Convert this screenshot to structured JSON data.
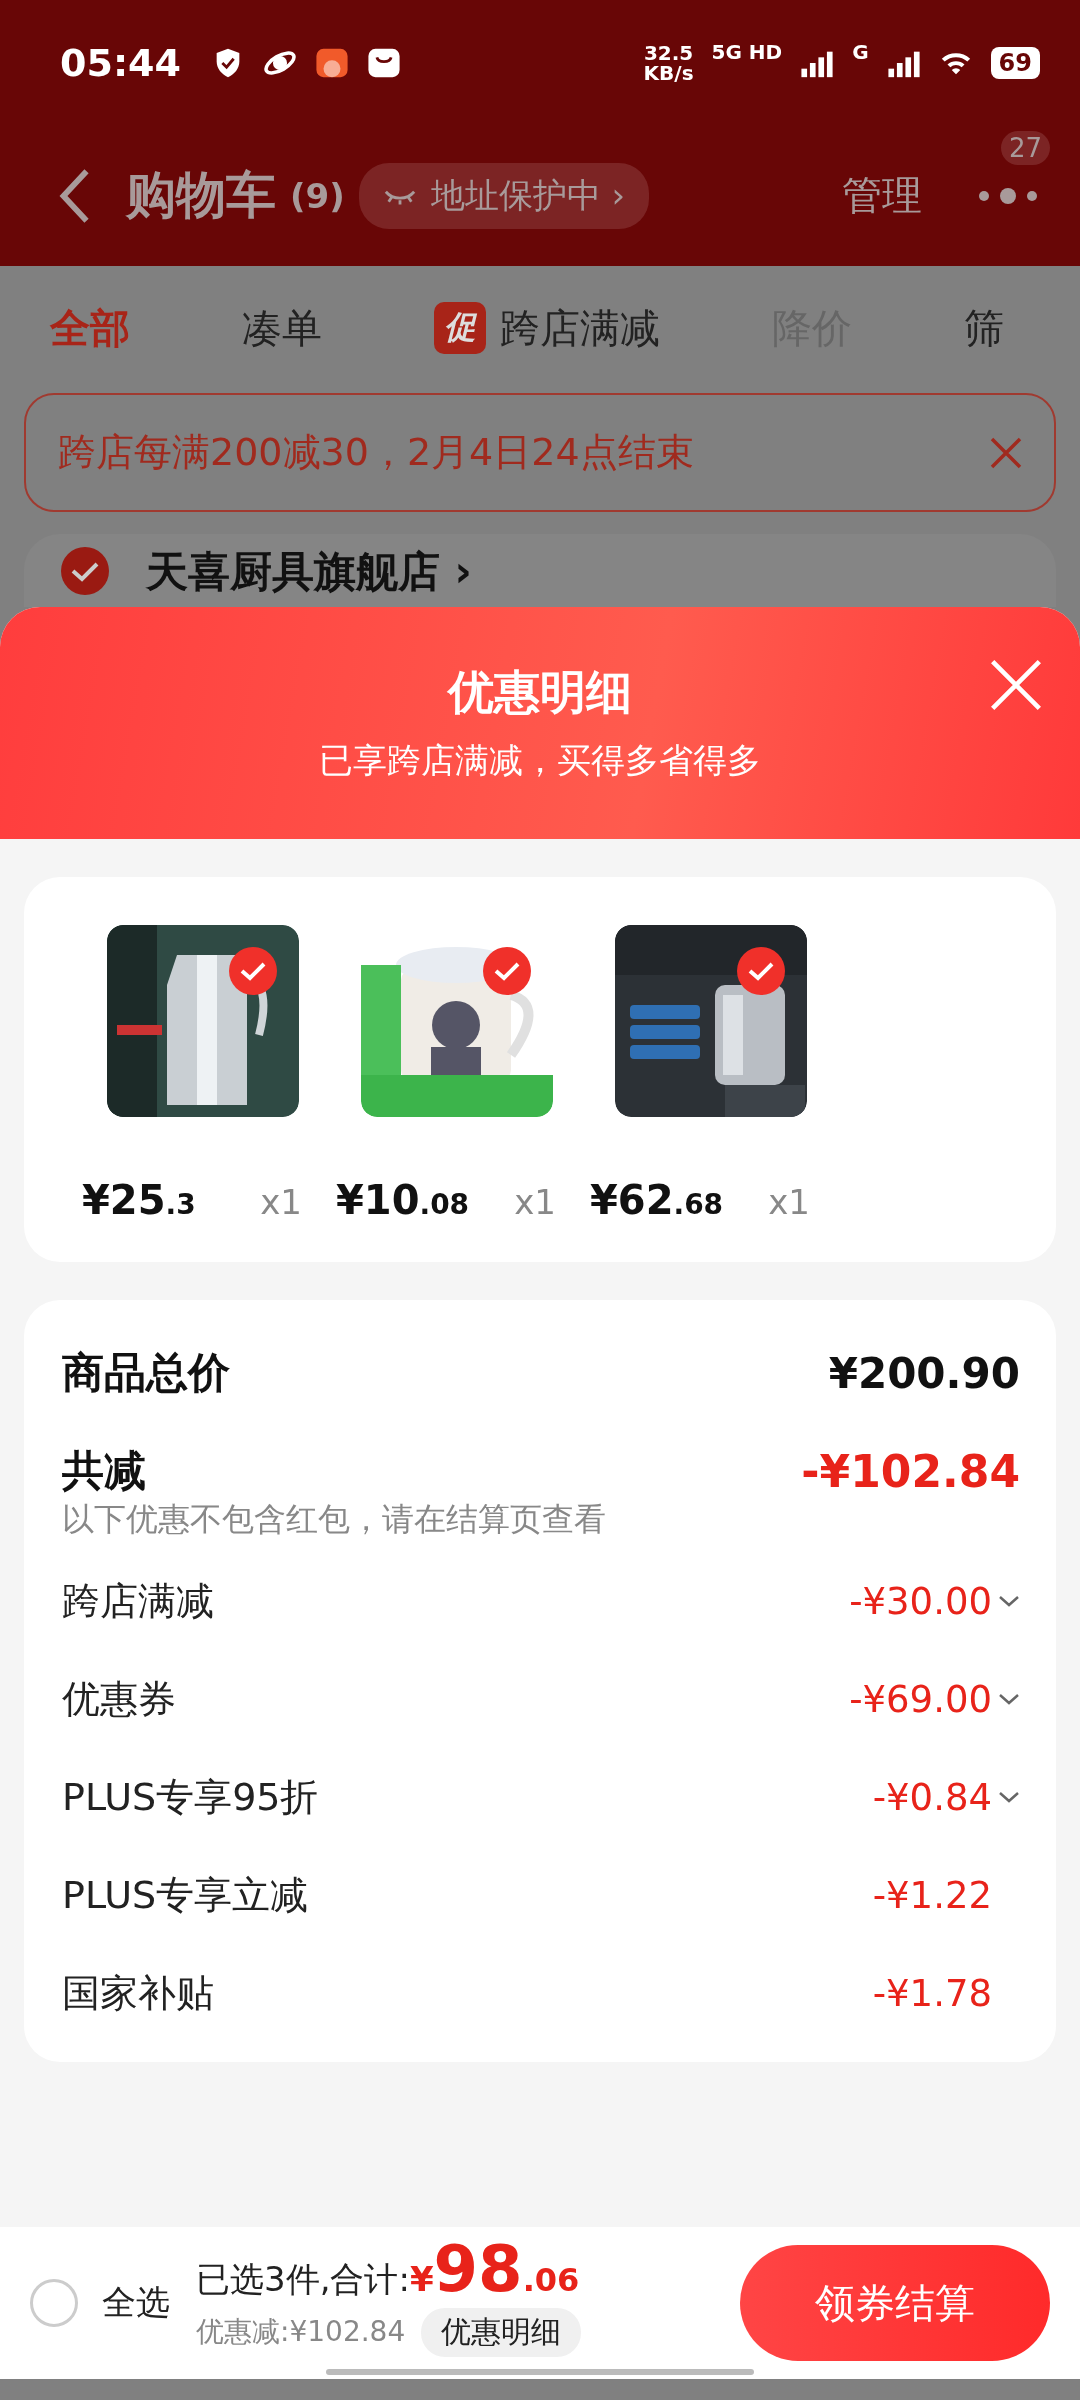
{
  "status_bar": {
    "time": "05:44",
    "speed_value": "32.5",
    "speed_unit": "KB/s",
    "network": "5G HD",
    "network_2": "G",
    "battery": "69"
  },
  "header": {
    "title": "购物车",
    "count": "(9)",
    "address_pill": "地址保护中 ›",
    "manage": "管理",
    "more_badge": "27"
  },
  "tabs": [
    {
      "label": "全部",
      "selected": true,
      "dimmed": false
    },
    {
      "label": "凑单",
      "selected": false,
      "dimmed": false
    },
    {
      "label": "跨店满减",
      "badge": "促",
      "selected": false,
      "dimmed": false
    },
    {
      "label": "降价",
      "selected": false,
      "dimmed": true
    },
    {
      "label": "筛",
      "selected": false,
      "dimmed": false
    }
  ],
  "promo_banner": {
    "text": "跨店每满200减30，2月4日24点结束"
  },
  "store": {
    "name": "天喜厨具旗舰店 ›",
    "checked": true
  },
  "sheet": {
    "title": "优惠明细",
    "subtitle": "已享跨店满减，买得多省得多",
    "products": [
      {
        "selected": true,
        "price_int": "¥25",
        "price_dec": ".3",
        "qty": "x1"
      },
      {
        "selected": true,
        "price_int": "¥10",
        "price_dec": ".08",
        "qty": "x1"
      },
      {
        "selected": true,
        "price_int": "¥62",
        "price_dec": ".68",
        "qty": "x1"
      }
    ],
    "total": {
      "label": "商品总价",
      "amount": "¥200.90"
    },
    "discount": {
      "label": "共减",
      "amount": "-¥102.84",
      "note": "以下优惠不包含红包，请在结算页查看"
    },
    "discount_rows": [
      {
        "label": "跨店满减",
        "amount": "-¥30.00",
        "expandable": true
      },
      {
        "label": "优惠券",
        "amount": "-¥69.00",
        "expandable": true
      },
      {
        "label": "PLUS专享95折",
        "amount": "-¥0.84",
        "expandable": true
      },
      {
        "label": "PLUS专享立减",
        "amount": "-¥1.22",
        "expandable": false
      },
      {
        "label": "国家补贴",
        "amount": "-¥1.78",
        "expandable": false
      }
    ]
  },
  "bottom_bar": {
    "select_all": "全选",
    "select_all_checked": false,
    "selected_label": "已选3件,合计:",
    "currency": "¥",
    "total_int": "98",
    "total_dec": ".06",
    "saved": "优惠减:¥102.84",
    "details_chip": "优惠明细",
    "checkout": "领券结算"
  }
}
